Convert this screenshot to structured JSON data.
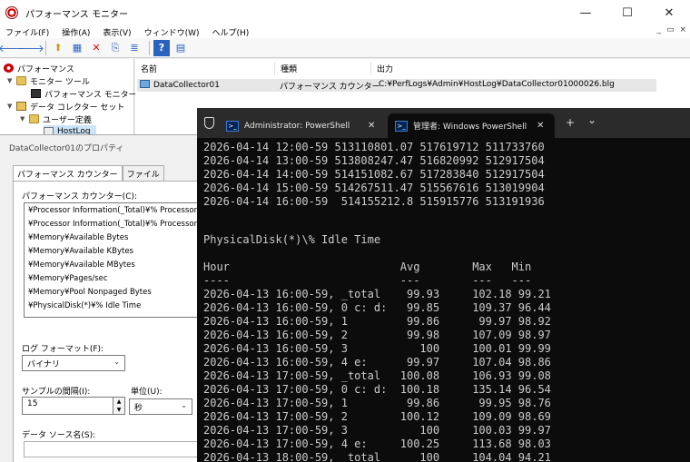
{
  "window": {
    "title": "パフォーマンス モニター",
    "controls": {
      "minimize": "—",
      "maximize": "☐",
      "close": "✕"
    }
  },
  "menu": {
    "items": [
      "ファイル(F)",
      "操作(A)",
      "表示(V)",
      "ウィンドウ(W)",
      "ヘルプ(H)"
    ],
    "controls": {
      "minimize": "_",
      "restore": "▭",
      "close": "×"
    }
  },
  "toolbar": {
    "back": "🡐",
    "forward": "🡒",
    "up": "⬆",
    "grid": "▦",
    "delete": "✕",
    "export": "⎘",
    "properties": "≣",
    "help": "?",
    "panel": "▤"
  },
  "tree": {
    "root": "パフォーマンス",
    "monitoring_tools": "モニター ツール",
    "perf_monitor": "パフォーマンス モニター",
    "data_collector_sets": "データ コレクター セット",
    "user_defined": "ユーザー定義",
    "hostlog": "HostLog"
  },
  "list": {
    "columns": [
      "名前",
      "種類",
      "出力"
    ],
    "row": {
      "name": "DataCollector01",
      "type": "パフォーマンス カウンター",
      "output": "C:¥PerfLogs¥Admin¥HostLog¥DataCollector01000026.blg"
    }
  },
  "dialog": {
    "title": "DataCollector01のプロパティ",
    "tabs": [
      "パフォーマンス カウンター",
      "ファイル"
    ],
    "counters_label": "パフォーマンス カウンター(C):",
    "counters": [
      "¥Processor Information(_Total)¥% Processor T",
      "¥Processor Information(_Total)¥% Processor U",
      "¥Memory¥Available Bytes",
      "¥Memory¥Available KBytes",
      "¥Memory¥Available MBytes",
      "¥Memory¥Pages/sec",
      "¥Memory¥Pool Nonpaged Bytes",
      "¥PhysicalDisk(*)¥% Idle Time"
    ],
    "log_format_label": "ログ フォーマット(F):",
    "log_format_value": "バイナリ",
    "interval_label": "サンプルの間隔(I):",
    "interval_value": "15",
    "unit_label": "単位(U):",
    "unit_value": "秒",
    "datasource_label": "データ ソース名(S):"
  },
  "terminal": {
    "tabs": [
      {
        "title": "Administrator: PowerShell",
        "active": false
      },
      {
        "title": "管理者: Windows PowerShell",
        "active": true
      }
    ],
    "new_tab": "+",
    "dropdown": "⌄",
    "close": "✕",
    "lines": [
      "2026-04-14 12:00-59 513110801.07 517619712 511733760",
      "2026-04-14 13:00-59 513808247.47 516820992 512917504",
      "2026-04-14 14:00-59 514151082.67 517283840 512917504",
      "2026-04-14 15:00-59 514267511.47 515567616 513019904",
      "2026-04-14 16:00-59  514155212.8 515915776 513191936",
      "",
      "",
      "PhysicalDisk(*)\\% Idle Time",
      "",
      "Hour                          Avg        Max   Min",
      "----                          ---        ---   ---",
      "2026-04-13 16:00-59, _total    99.93     102.18 99.21",
      "2026-04-13 16:00-59, 0 c: d:   99.85     109.37 96.44",
      "2026-04-13 16:00-59, 1         99.86      99.97 98.92",
      "2026-04-13 16:00-59, 2         99.98     107.09 98.97",
      "2026-04-13 16:00-59, 3           100     100.01 99.99",
      "2026-04-13 16:00-59, 4 e:      99.97     107.04 98.86",
      "2026-04-13 17:00-59, _total   100.08     106.93 99.08",
      "2026-04-13 17:00-59, 0 c: d:  100.18     135.14 96.54",
      "2026-04-13 17:00-59, 1         99.86      99.95 98.76",
      "2026-04-13 17:00-59, 2        100.12     109.09 98.69",
      "2026-04-13 17:00-59, 3           100     100.03 99.97",
      "2026-04-13 17:00-59, 4 e:     100.25     113.68 98.03",
      "2026-04-13 18:00-59, _total      100     104.04 94.21"
    ]
  }
}
